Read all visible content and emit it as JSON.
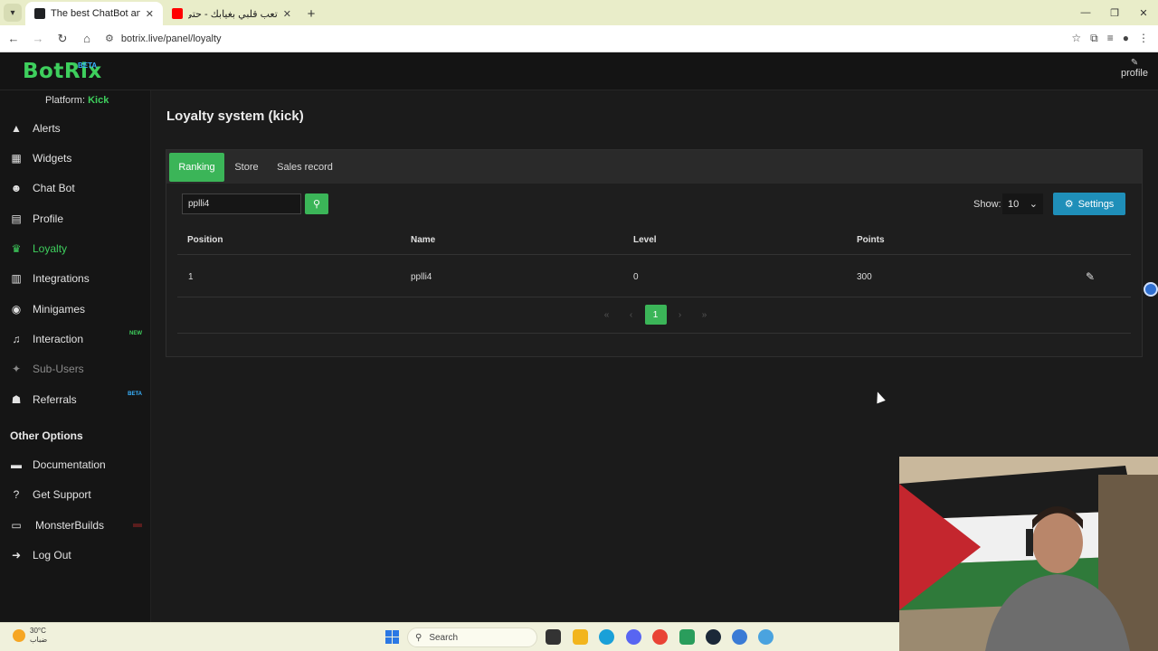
{
  "browser": {
    "tabs": [
      {
        "title": "The best ChatBot and Widgets",
        "active": true,
        "favicon_color": "#202124"
      },
      {
        "title": "تعب قلبي بغيابك - حتى الورد كذا",
        "active": false,
        "favicon_color": "#ff0000"
      }
    ],
    "url": "botrix.live/panel/loyalty"
  },
  "header": {
    "logo": "BotRix",
    "logo_badge": "BETA",
    "profile_label": "profile"
  },
  "sidebar": {
    "platform_label": "Platform:",
    "platform_value": "Kick",
    "items": [
      {
        "label": "Alerts",
        "icon": "warning-icon",
        "glyph": "▲"
      },
      {
        "label": "Widgets",
        "icon": "grid-icon",
        "glyph": "▦"
      },
      {
        "label": "Chat Bot",
        "icon": "robot-icon",
        "glyph": "☻"
      },
      {
        "label": "Profile",
        "icon": "id-card-icon",
        "glyph": "▤"
      },
      {
        "label": "Loyalty",
        "icon": "trophy-icon",
        "glyph": "♛"
      },
      {
        "label": "Integrations",
        "icon": "table-icon",
        "glyph": "▥"
      },
      {
        "label": "Minigames",
        "icon": "gamepad-icon",
        "glyph": "◉"
      },
      {
        "label": "Interaction",
        "icon": "music-icon",
        "glyph": "♫",
        "badge": "NEW"
      },
      {
        "label": "Sub-Users",
        "icon": "users-icon",
        "glyph": "✦"
      },
      {
        "label": "Referrals",
        "icon": "users-icon",
        "glyph": "☗",
        "badge": "BETA"
      }
    ],
    "other_title": "Other Options",
    "other_items": [
      {
        "label": "Documentation",
        "icon": "book-icon",
        "glyph": "▬"
      },
      {
        "label": "Get Support",
        "icon": "question-icon",
        "glyph": "?"
      },
      {
        "label": "MonsterBuilds",
        "icon": "laptop-icon",
        "glyph": "▭"
      },
      {
        "label": "Log Out",
        "icon": "logout-icon",
        "glyph": "➜"
      }
    ]
  },
  "main": {
    "title": "Loyalty system (kick)",
    "tabs": [
      "Ranking",
      "Store",
      "Sales record"
    ],
    "search_value": "pplli4",
    "show_label": "Show:",
    "show_value": "10",
    "settings_label": "Settings",
    "table": {
      "headers": [
        "Position",
        "Name",
        "Level",
        "Points"
      ],
      "rows": [
        {
          "position": "1",
          "name": "pplli4",
          "level": "0",
          "points": "300"
        }
      ]
    },
    "pagination": {
      "current": "1",
      "first": "«",
      "prev": "‹",
      "next": "›",
      "last": "»"
    }
  },
  "taskbar": {
    "temperature": "30°C",
    "weather_condition": "ضباب",
    "weather_badge": "3",
    "search_placeholder": "Search"
  },
  "colors": {
    "accent": "#3bb558",
    "settings": "#1f8fb9",
    "new_badge": "#3ecf5d",
    "beta_badge": "#39b3ff",
    "monster_badge": "#c0392b"
  }
}
